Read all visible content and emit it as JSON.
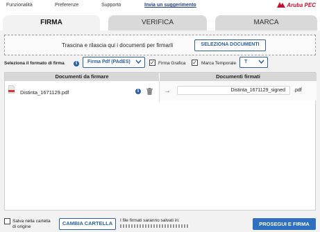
{
  "topnav": {
    "items": [
      "Funzionalità",
      "Preferenze",
      "Supporto"
    ],
    "suggestion_link": "Invia un suggerimento",
    "logo_text": "Aruba PEC"
  },
  "tabs": [
    "FIRMA",
    "VERIFICA",
    "MARCA"
  ],
  "active_tab": "FIRMA",
  "dropzone": {
    "text": "Trascina e rilascia qui i documenti per firmarli",
    "button": "SELEZIONA DOCUMENTI"
  },
  "options": {
    "format_label": "Seleziona il formato di firma",
    "format_value": "Firma Pdf (PAdES)",
    "graphic_signature_label": "Firma Grafica",
    "graphic_signature_checked": true,
    "timestamp_label": "Marca Temporale",
    "timestamp_checked": true,
    "timestamp_value": "T"
  },
  "table": {
    "left_header": "Documenti da firmare",
    "right_header": "Documenti firmati",
    "rows": [
      {
        "input_file": "Distinta_1671129.pdf",
        "output_name": "Distinta_1671129_signed",
        "output_ext": ".pdf"
      }
    ]
  },
  "bottom": {
    "save_origin_label": "Salva nella cartella di origine",
    "save_origin_checked": false,
    "change_folder_button": "CAMBIA CARTELLA",
    "save_info": "I file firmati saranno salvati in:",
    "proceed_button": "PROSEGUI E FIRMA"
  },
  "colors": {
    "accent": "#2b5ea3",
    "primary": "#2f6fc2",
    "brand": "#c8102e"
  }
}
